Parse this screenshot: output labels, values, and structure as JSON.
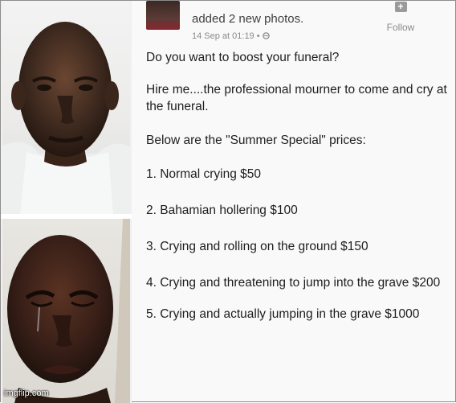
{
  "post": {
    "header_action": "added 2 new photos.",
    "timestamp": "14 Sep at 01:19 • ",
    "follow_label": "Follow",
    "follow_icon": "+",
    "question": "Do you want to boost your funeral?",
    "hire": "Hire me....the professional mourner to come and cry at the funeral.",
    "prices_intro": "Below are the \"Summer Special\"  prices:",
    "prices": [
      "1. Normal crying $50",
      "2. Bahamian hollering $100",
      "3. Crying and rolling on the ground $150",
      "4. Crying and threatening to jump into the grave $200",
      "5. Crying and actually jumping in the grave $1000"
    ]
  },
  "watermark": "imgflip.com"
}
